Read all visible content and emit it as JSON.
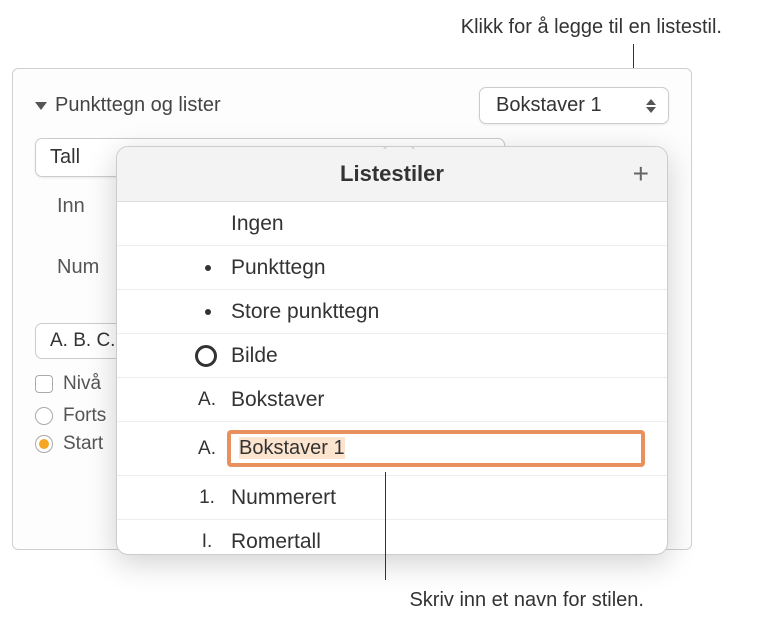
{
  "callouts": {
    "top": "Klikk for å legge til en listestil.",
    "bottom": "Skriv inn et navn for stilen."
  },
  "section": {
    "title": "Punkttegn og lister",
    "style_dropdown": "Bokstaver 1",
    "type_dropdown": "Tall",
    "indent_label": "Inn",
    "number_label": "Num",
    "format_dropdown": "A. B. C.",
    "tier_checkbox": "Nivå",
    "continue_radio": "Forts",
    "start_radio": "Start"
  },
  "popover": {
    "title": "Listestiler",
    "add_icon": "+",
    "items": [
      {
        "marker": "",
        "label": "Ingen",
        "type": "none"
      },
      {
        "marker": "•",
        "label": "Punkttegn",
        "type": "dot"
      },
      {
        "marker": "•",
        "label": "Store punkttegn",
        "type": "dot"
      },
      {
        "marker": "○",
        "label": "Bilde",
        "type": "circle"
      },
      {
        "marker": "A.",
        "label": "Bokstaver",
        "type": "text"
      },
      {
        "marker": "A.",
        "label": "Bokstaver 1",
        "type": "edit"
      },
      {
        "marker": "1.",
        "label": "Nummerert",
        "type": "text"
      },
      {
        "marker": "I.",
        "label": "Romertall",
        "type": "text"
      }
    ]
  }
}
